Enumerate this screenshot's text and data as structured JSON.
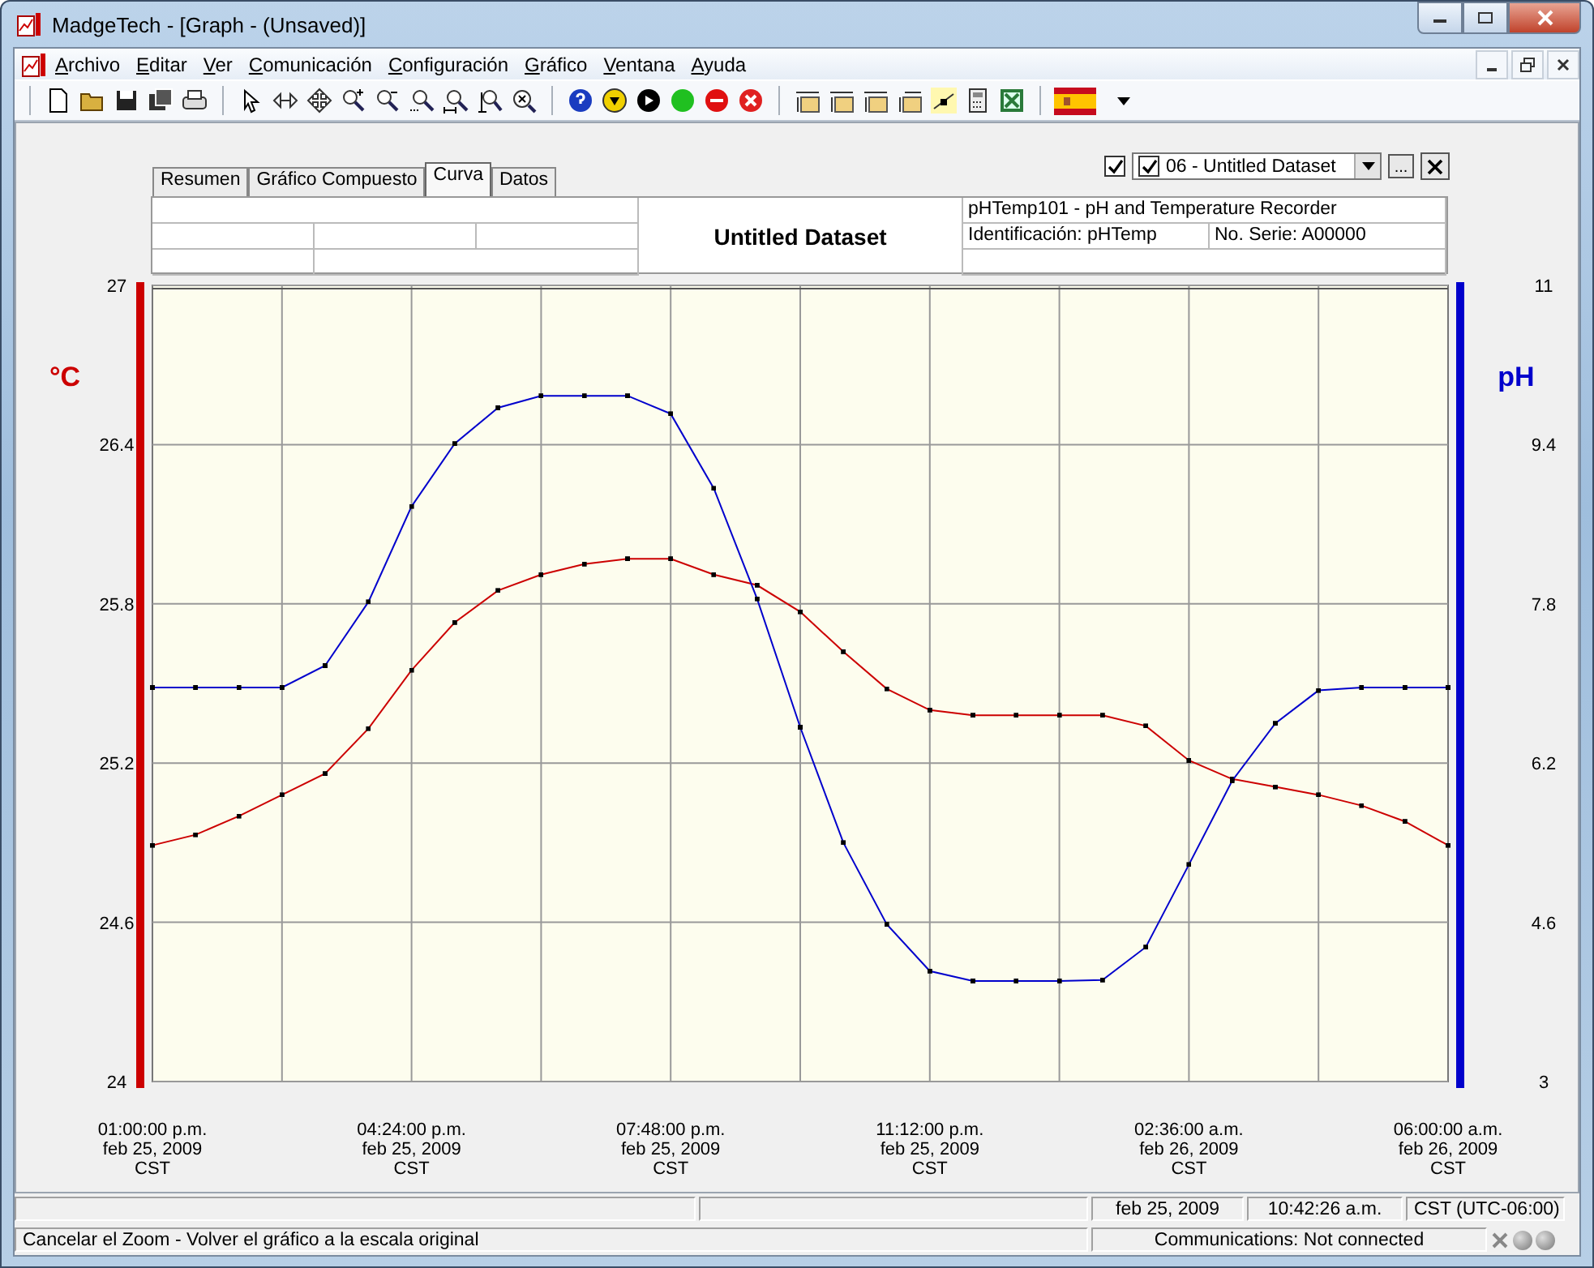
{
  "window": {
    "title": "MadgeTech - [Graph - (Unsaved)]"
  },
  "menu": [
    "Archivo",
    "Editar",
    "Ver",
    "Comunicación",
    "Configuración",
    "Gráfico",
    "Ventana",
    "Ayuda"
  ],
  "tabs": [
    {
      "label": "Resumen",
      "selected": false
    },
    {
      "label": "Gráfico Compuesto",
      "selected": false
    },
    {
      "label": "Curva",
      "selected": true
    },
    {
      "label": "Datos",
      "selected": false
    }
  ],
  "dataset_selector": {
    "show_all_checked": true,
    "dataset_checked": true,
    "value": "06 - Untitled Dataset",
    "more_button": "..."
  },
  "header": {
    "title": "Untitled Dataset",
    "device": "pHTemp101 - pH and Temperature Recorder",
    "identification": "Identificación: pHTemp",
    "serial": "No. Serie: A00000"
  },
  "chart_data": {
    "type": "line",
    "grid": true,
    "ylabel": "°C",
    "y2label": "pH",
    "categories": [
      "01:00:00 p.m.\nfeb 25, 2009\nCST",
      null,
      null,
      null,
      null,
      null,
      "04:24:00 p.m.\nfeb 25, 2009\nCST",
      null,
      null,
      null,
      null,
      null,
      "07:48:00 p.m.\nfeb 25, 2009\nCST",
      null,
      null,
      null,
      null,
      null,
      "11:12:00 p.m.\nfeb 25, 2009\nCST",
      null,
      null,
      null,
      null,
      null,
      "02:36:00 a.m.\nfeb 26, 2009\nCST",
      null,
      null,
      null,
      null,
      null,
      "06:00:00 a.m.\nfeb 26, 2009\nCST"
    ],
    "series": [
      {
        "color": "#cc0000",
        "values": [
          24.89,
          24.93,
          25.0,
          25.08,
          25.16,
          25.33,
          25.55,
          25.73,
          25.85,
          25.91,
          25.95,
          25.97,
          25.97,
          25.91,
          25.87,
          25.77,
          25.62,
          25.48,
          25.4,
          25.38,
          25.38,
          25.38,
          25.38,
          25.34,
          25.21,
          25.14,
          25.11,
          25.08,
          25.04,
          24.98,
          24.89
        ]
      },
      {
        "color": "#0000cc",
        "axis": "y2",
        "values": [
          6.96,
          6.96,
          6.96,
          6.96,
          7.18,
          7.82,
          8.78,
          9.41,
          9.77,
          9.89,
          9.89,
          9.89,
          9.71,
          8.96,
          7.85,
          6.56,
          5.4,
          4.58,
          4.11,
          4.01,
          4.01,
          4.01,
          4.02,
          4.35,
          5.18,
          6.02,
          6.6,
          6.93,
          6.96,
          6.96,
          6.96
        ]
      }
    ],
    "ylim": [
      24,
      27
    ],
    "y2lim": [
      3,
      11
    ],
    "yticks": [
      24,
      24.6,
      25.2,
      25.8,
      26.4,
      27
    ],
    "y2ticks": [
      3,
      4.6,
      6.2,
      7.8,
      9.4,
      11
    ]
  },
  "status_bar": {
    "date": "feb 25, 2009",
    "time": "10:42:26 a.m.",
    "timezone": "CST (UTC-06:00)",
    "message": "Cancelar el Zoom - Volver el gráfico a la escala original",
    "communications": "Communications: Not connected"
  }
}
